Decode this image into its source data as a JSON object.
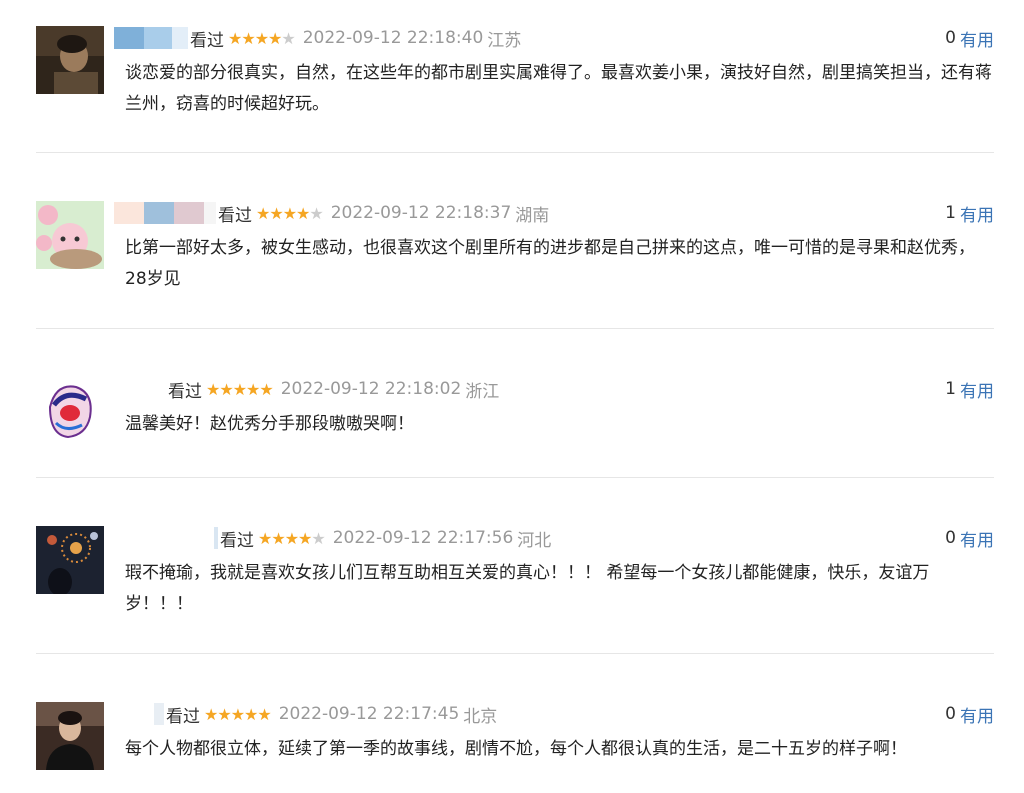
{
  "reviews": [
    {
      "watched": "看过",
      "rating": 4,
      "time": "2022-09-12 22:18:40",
      "location": "江苏",
      "useful_count": "0",
      "useful_label": "有用",
      "content": "谈恋爱的部分很真实，自然，在这些年的都市剧里实属难得了。最喜欢姜小果，演技好自然，剧里搞笑担当，还有蒋兰州，窃喜的时候超好玩。"
    },
    {
      "watched": "看过",
      "rating": 4,
      "time": "2022-09-12 22:18:37",
      "location": "湖南",
      "useful_count": "1",
      "useful_label": "有用",
      "content": "比第一部好太多，被女生感动，也很喜欢这个剧里所有的进步都是自己拼来的这点，唯一可惜的是寻果和赵优秀，28岁见"
    },
    {
      "watched": "看过",
      "rating": 5,
      "time": "2022-09-12 22:18:02",
      "location": "浙江",
      "useful_count": "1",
      "useful_label": "有用",
      "content": "温馨美好！赵优秀分手那段嗷嗷哭啊！"
    },
    {
      "watched": "看过",
      "rating": 4,
      "time": "2022-09-12 22:17:56",
      "location": "河北",
      "useful_count": "0",
      "useful_label": "有用",
      "content": "瑕不掩瑜，我就是喜欢女孩儿们互帮互助相互关爱的真心！！！ 希望每一个女孩儿都能健康，快乐，友谊万岁！！！"
    },
    {
      "watched": "看过",
      "rating": 5,
      "time": "2022-09-12 22:17:45",
      "location": "北京",
      "useful_count": "0",
      "useful_label": "有用",
      "content": "每个人物都很立体，延续了第一季的故事线，剧情不尬，每个人都很认真的生活，是二十五岁的样子啊！"
    }
  ],
  "colors": {
    "star": "#f5a623",
    "star_empty": "#cccccc",
    "meta_gray": "#999999",
    "link_blue": "#3b74b5",
    "divider": "#e6e6e6"
  },
  "icons": [
    "avatar",
    "star-icon"
  ]
}
